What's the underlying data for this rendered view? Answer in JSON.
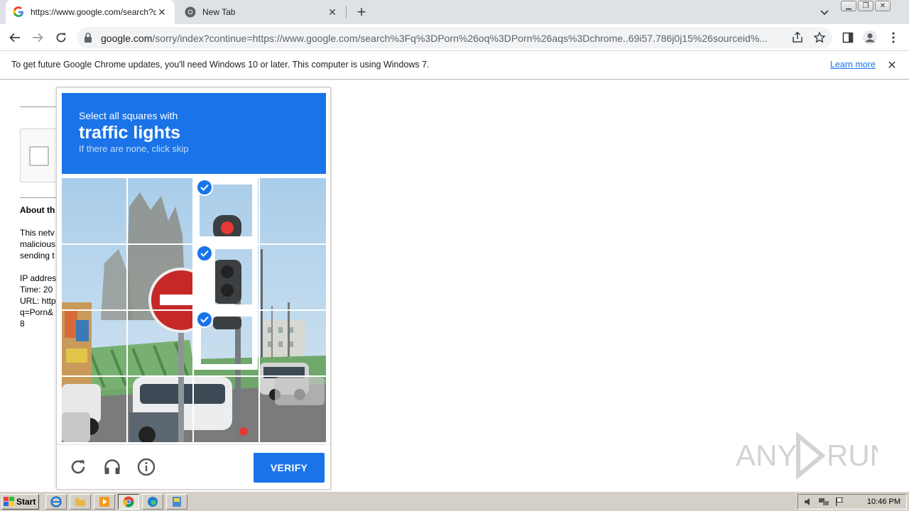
{
  "browser": {
    "tabs": [
      {
        "title": "https://www.google.com/search?q=",
        "active": true,
        "icon": "google-g-icon"
      },
      {
        "title": "New Tab",
        "active": false,
        "icon": "chrome-icon"
      }
    ],
    "address_host": "google.com",
    "address_path": "/sorry/index?continue=https://www.google.com/search%3Fq%3DPorn%26oq%3DPorn%26aqs%3Dchrome..69i57.786j0j15%26sourceid%..."
  },
  "infobar": {
    "message": "To get future Google Chrome updates, you'll need Windows 10 or later. This computer is using Windows 7.",
    "link": "Learn more"
  },
  "background_page": {
    "heading": "About th",
    "paragraph_lines": [
      "This netv",
      "malicious",
      "sending t"
    ],
    "detail_lines": [
      "IP addres",
      "Time: 20",
      "URL: http",
      "q=Porn&",
      "8"
    ]
  },
  "captcha": {
    "instruction": "Select all squares with",
    "target": "traffic lights",
    "hint": "If there are none, click skip",
    "verify_label": "VERIFY",
    "accent_color": "#1a73e8",
    "selected_tiles": [
      [
        0,
        2
      ],
      [
        1,
        2
      ],
      [
        2,
        2
      ]
    ]
  },
  "watermark": {
    "text": "ANY RUN"
  },
  "taskbar": {
    "start_label": "Start",
    "clock": "10:46 PM"
  }
}
